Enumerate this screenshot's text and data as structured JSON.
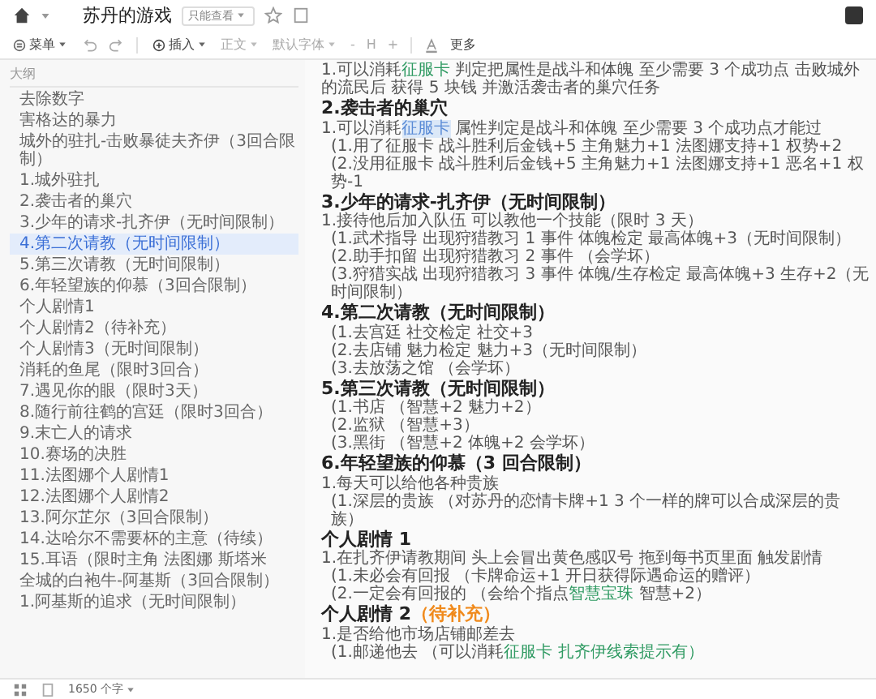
{
  "window": {
    "title": "苏丹的游戏",
    "permission": "只能查看"
  },
  "toolbar": {
    "menu": "菜单",
    "insert": "插入",
    "style": "正文",
    "font": "默认字体",
    "size_down": "-",
    "size": "H",
    "size_up": "+",
    "more": "更多"
  },
  "outline": {
    "title": "大纲",
    "items": [
      {
        "label": "去除数字",
        "selected": false
      },
      {
        "label": "害格达的暴力",
        "selected": false
      },
      {
        "label": "城外的驻扎-击败暴徒夫齐伊（3回合限制）",
        "selected": false
      },
      {
        "label": "1.城外驻扎",
        "selected": false
      },
      {
        "label": "2.袭击者的巢穴",
        "selected": false
      },
      {
        "label": "3.少年的请求-扎齐伊（无时间限制）",
        "selected": false
      },
      {
        "label": "4.第二次请教（无时间限制）",
        "selected": true
      },
      {
        "label": "5.第三次请教（无时间限制）",
        "selected": false
      },
      {
        "label": "6.年轻望族的仰慕（3回合限制）",
        "selected": false
      },
      {
        "label": "个人剧情1",
        "selected": false
      },
      {
        "label": "个人剧情2（待补充）",
        "selected": false
      },
      {
        "label": "个人剧情3（无时间限制）",
        "selected": false
      },
      {
        "label": "消耗的鱼尾（限时3回合）",
        "selected": false
      },
      {
        "label": "7.遇见你的眼（限时3天）",
        "selected": false
      },
      {
        "label": "8.随行前往鹤的宫廷（限时3回合）",
        "selected": false
      },
      {
        "label": "9.末亡人的请求",
        "selected": false
      },
      {
        "label": "10.赛场的决胜",
        "selected": false
      },
      {
        "label": "11.法图娜个人剧情1",
        "selected": false
      },
      {
        "label": "12.法图娜个人剧情2",
        "selected": false
      },
      {
        "label": "13.阿尔芷尔（3回合限制）",
        "selected": false
      },
      {
        "label": "14.达哈尔不需要杯的主意（待续）",
        "selected": false
      },
      {
        "label": "15.耳语（限时主角 法图娜 斯塔米",
        "selected": false
      },
      {
        "label": "全城的白袍牛-阿基斯（3回合限制）",
        "selected": false
      },
      {
        "label": "1.阿基斯的追求（无时间限制）",
        "selected": false
      }
    ]
  },
  "document": {
    "blocks": [
      {
        "kind": "item",
        "parts": [
          {
            "kind": "plain",
            "text": "1.可以消耗"
          },
          {
            "kind": "link",
            "text": "征服卡"
          },
          {
            "kind": "plain",
            "text": " 判定把属性是战斗和体魄 至少需要 3 个成功点 击败城外的流民后 获得 5 块钱 并激活袭击者的巢穴任务"
          }
        ]
      },
      {
        "kind": "heading",
        "parts": [
          {
            "kind": "plain",
            "text": "2.袭击者的巢穴"
          }
        ]
      },
      {
        "kind": "item",
        "parts": [
          {
            "kind": "plain",
            "text": "1.可以消耗"
          },
          {
            "kind": "mark",
            "text": "征服卡"
          },
          {
            "kind": "plain",
            "text": " 属性判定是战斗和体魄 至少需要 3 个成功点才能过"
          }
        ]
      },
      {
        "kind": "subitem",
        "parts": [
          {
            "kind": "plain",
            "text": "(1.用了征服卡 战斗胜利后金钱+5 主角魅力+1 法图娜支持+1 权势+2"
          }
        ]
      },
      {
        "kind": "subitem",
        "parts": [
          {
            "kind": "plain",
            "text": "(2.没用征服卡 战斗胜利后金钱+5 主角魅力+1 法图娜支持+1 恶名+1 权势-1"
          }
        ]
      },
      {
        "kind": "heading",
        "parts": [
          {
            "kind": "plain",
            "text": "3.少年的请求-扎齐伊（无时间限制）"
          }
        ]
      },
      {
        "kind": "item",
        "parts": [
          {
            "kind": "plain",
            "text": "1.接待他后加入队伍 可以教他一个技能（限时 3 天）"
          }
        ]
      },
      {
        "kind": "subitem",
        "parts": [
          {
            "kind": "plain",
            "text": "(1.武术指导 出现狩猎教习 1 事件 体魄检定 最高体魄+3（无时间限制）"
          }
        ]
      },
      {
        "kind": "subitem",
        "parts": [
          {
            "kind": "plain",
            "text": "(2.助手扣留 出现狩猎教习 2 事件 （会学坏）"
          }
        ]
      },
      {
        "kind": "subitem",
        "parts": [
          {
            "kind": "plain",
            "text": "(3.狩猎实战 出现狩猎教习 3 事件 体魄/生存检定 最高体魄+3 生存+2（无时间限制）"
          }
        ]
      },
      {
        "kind": "heading",
        "parts": [
          {
            "kind": "plain",
            "text": "4.第二次请教（无时间限制）"
          }
        ]
      },
      {
        "kind": "subitem",
        "parts": [
          {
            "kind": "plain",
            "text": "(1.去宫廷 社交检定 社交+3"
          }
        ]
      },
      {
        "kind": "subitem",
        "parts": [
          {
            "kind": "plain",
            "text": "(2.去店铺 魅力检定 魅力+3（无时间限制）"
          }
        ]
      },
      {
        "kind": "subitem",
        "parts": [
          {
            "kind": "plain",
            "text": "(3.去放荡之馆 （会学坏）"
          }
        ]
      },
      {
        "kind": "heading",
        "parts": [
          {
            "kind": "plain",
            "text": "5.第三次请教（无时间限制）"
          }
        ]
      },
      {
        "kind": "subitem",
        "parts": [
          {
            "kind": "plain",
            "text": "(1.书店 （智慧+2 魅力+2）"
          }
        ]
      },
      {
        "kind": "subitem",
        "parts": [
          {
            "kind": "plain",
            "text": "(2.监狱 （智慧+3）"
          }
        ]
      },
      {
        "kind": "subitem",
        "parts": [
          {
            "kind": "plain",
            "text": "(3.黑街 （智慧+2 体魄+2 会学坏）"
          }
        ]
      },
      {
        "kind": "heading",
        "parts": [
          {
            "kind": "plain",
            "text": "6.年轻望族的仰慕（3 回合限制）"
          }
        ]
      },
      {
        "kind": "item",
        "parts": [
          {
            "kind": "plain",
            "text": "1.每天可以给他各种贵族"
          }
        ]
      },
      {
        "kind": "subitem",
        "parts": [
          {
            "kind": "plain",
            "text": "(1.深层的贵族 （对苏丹的恋情卡牌+1 3 个一样的牌可以合成深层的贵族）"
          }
        ]
      },
      {
        "kind": "heading",
        "parts": [
          {
            "kind": "plain",
            "text": "个人剧情 1"
          }
        ]
      },
      {
        "kind": "item",
        "parts": [
          {
            "kind": "plain",
            "text": "1.在扎齐伊请教期间 头上会冒出黄色感叹号 拖到每书页里面 触发剧情"
          }
        ]
      },
      {
        "kind": "subitem",
        "parts": [
          {
            "kind": "plain",
            "text": "(1.未必会有回报 （卡牌命运+1 开日获得际遇命运的赠评）"
          }
        ]
      },
      {
        "kind": "subitem",
        "parts": [
          {
            "kind": "plain",
            "text": "(2.一定会有回报的 （会给个指点"
          },
          {
            "kind": "link",
            "text": "智慧宝珠"
          },
          {
            "kind": "plain",
            "text": " 智慧+2）"
          }
        ]
      },
      {
        "kind": "heading",
        "parts": [
          {
            "kind": "plain",
            "text": "个人剧情 2"
          },
          {
            "kind": "note",
            "text": "（待补充）"
          }
        ]
      },
      {
        "kind": "item",
        "parts": [
          {
            "kind": "plain",
            "text": "1.是否给他市场店铺邮差去"
          }
        ]
      },
      {
        "kind": "subitem",
        "parts": [
          {
            "kind": "plain",
            "text": "(1.邮递他去 （可以消耗"
          },
          {
            "kind": "link",
            "text": "征服卡 扎齐伊线索提示有）"
          }
        ]
      }
    ]
  },
  "status_bar": {
    "word_count": "1650 个字"
  }
}
